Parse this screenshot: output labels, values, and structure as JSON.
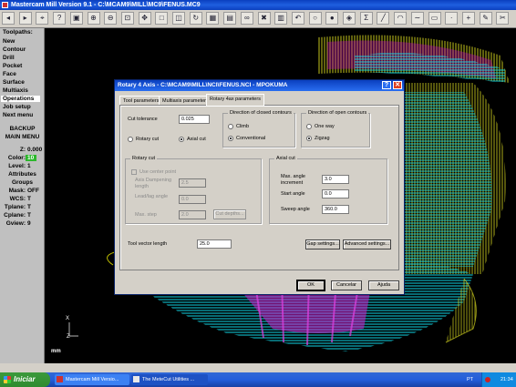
{
  "app": {
    "title": "Mastercam Mill Version 9.1 - C:\\MCAM9\\MILL\\MC9\\FENUS.MC9"
  },
  "toolbar": {
    "icons": [
      "back-arrow-icon",
      "forward-arrow-icon",
      "select-icon",
      "help-icon",
      "gview-top-icon",
      "zoom-icon",
      "unzoom-icon",
      "zoom-window-icon",
      "pan-icon",
      "screen-fit-icon",
      "gview-icon",
      "rotate-icon",
      "repaint-icon",
      "print-icon",
      "chain-icon",
      "delete-icon",
      "layer-icon",
      "undo-icon",
      "circle-icon",
      "sphere-icon",
      "analyze-icon",
      "sigma-icon",
      "line-icon",
      "arc-icon",
      "spline-icon",
      "rectangle-icon",
      "point-icon",
      "plus-icon",
      "edit-icon",
      "trim-icon"
    ]
  },
  "left_menu": {
    "header": "Toolpaths:",
    "items": [
      "New",
      "Contour",
      "Drill",
      "Pocket",
      "Face",
      "Surface",
      "Multiaxis",
      "Operations",
      "Job setup",
      "Next menu"
    ],
    "selected_index": 7,
    "buttons": [
      "BACKUP",
      "MAIN MENU"
    ],
    "settings": [
      {
        "key": "Z:",
        "value": "0.000"
      },
      {
        "key": "Color:",
        "value": "10"
      },
      {
        "key": "Level:",
        "value": "1"
      },
      {
        "key": "",
        "value": "Attributes"
      },
      {
        "key": "",
        "value": "Groups"
      },
      {
        "key": "Mask:",
        "value": "OFF"
      },
      {
        "key": "WCS:",
        "value": "T"
      },
      {
        "key": "Tplane:",
        "value": "T"
      },
      {
        "key": "Cplane:",
        "value": "T"
      },
      {
        "key": "Gview:",
        "value": "9"
      }
    ]
  },
  "graphics": {
    "axis_x": "X",
    "axis_z": "Z",
    "corner_label": "mm"
  },
  "dialog": {
    "title": "Rotary 4 Axis - C:\\MCAM9\\MILL\\NCI\\FENUS.NCI - MPOKUMA",
    "tabs": [
      "Tool parameters",
      "Multiaxis parameters",
      "Rotary 4ax parameters"
    ],
    "active_tab": 2,
    "cut_tolerance": {
      "label": "Cut tolerance",
      "value": "0.025"
    },
    "cut_type": {
      "options": [
        "Rotary cut",
        "Axial cut"
      ],
      "selected": "Axial cut"
    },
    "closed_contours": {
      "label": "Direction of closed contours",
      "options": [
        "Climb",
        "Conventional"
      ],
      "selected": "Conventional"
    },
    "open_contours": {
      "label": "Direction of open contours",
      "options": [
        "One way",
        "Zigzag"
      ],
      "selected": "Zigzag"
    },
    "rotary_cut": {
      "label": "Rotary cut",
      "use_center_point": "Use center point",
      "axis_dampening_label": "Axis Dampening length",
      "axis_dampening_value": "2.5",
      "lead_lag_label": "Lead/lag angle",
      "lead_lag_value": "0.0",
      "max_step_label": "Max. step",
      "max_step_value": "2.0",
      "cut_depths_button": "Cut depths..."
    },
    "axial_cut": {
      "label": "Axial cut",
      "max_angle_label": "Max. angle increment",
      "max_angle_value": "3.0",
      "start_angle_label": "Start angle",
      "start_angle_value": "0.0",
      "sweep_angle_label": "Sweep angle",
      "sweep_angle_value": "360.0"
    },
    "tool_vector": {
      "label": "Tool vector length",
      "value": "25.0"
    },
    "gap_settings_button": "Gap settings...",
    "advanced_settings_button": "Advanced settings...",
    "ok_button": "OK",
    "cancel_button": "Cancelar",
    "help_button": "Ajuda"
  },
  "taskbar": {
    "start_label": "Iniciar",
    "tasks": [
      "Mastercam Mill Versio...",
      "The MeteCut Utilities ..."
    ],
    "language": "PT",
    "clock": "21:34"
  }
}
